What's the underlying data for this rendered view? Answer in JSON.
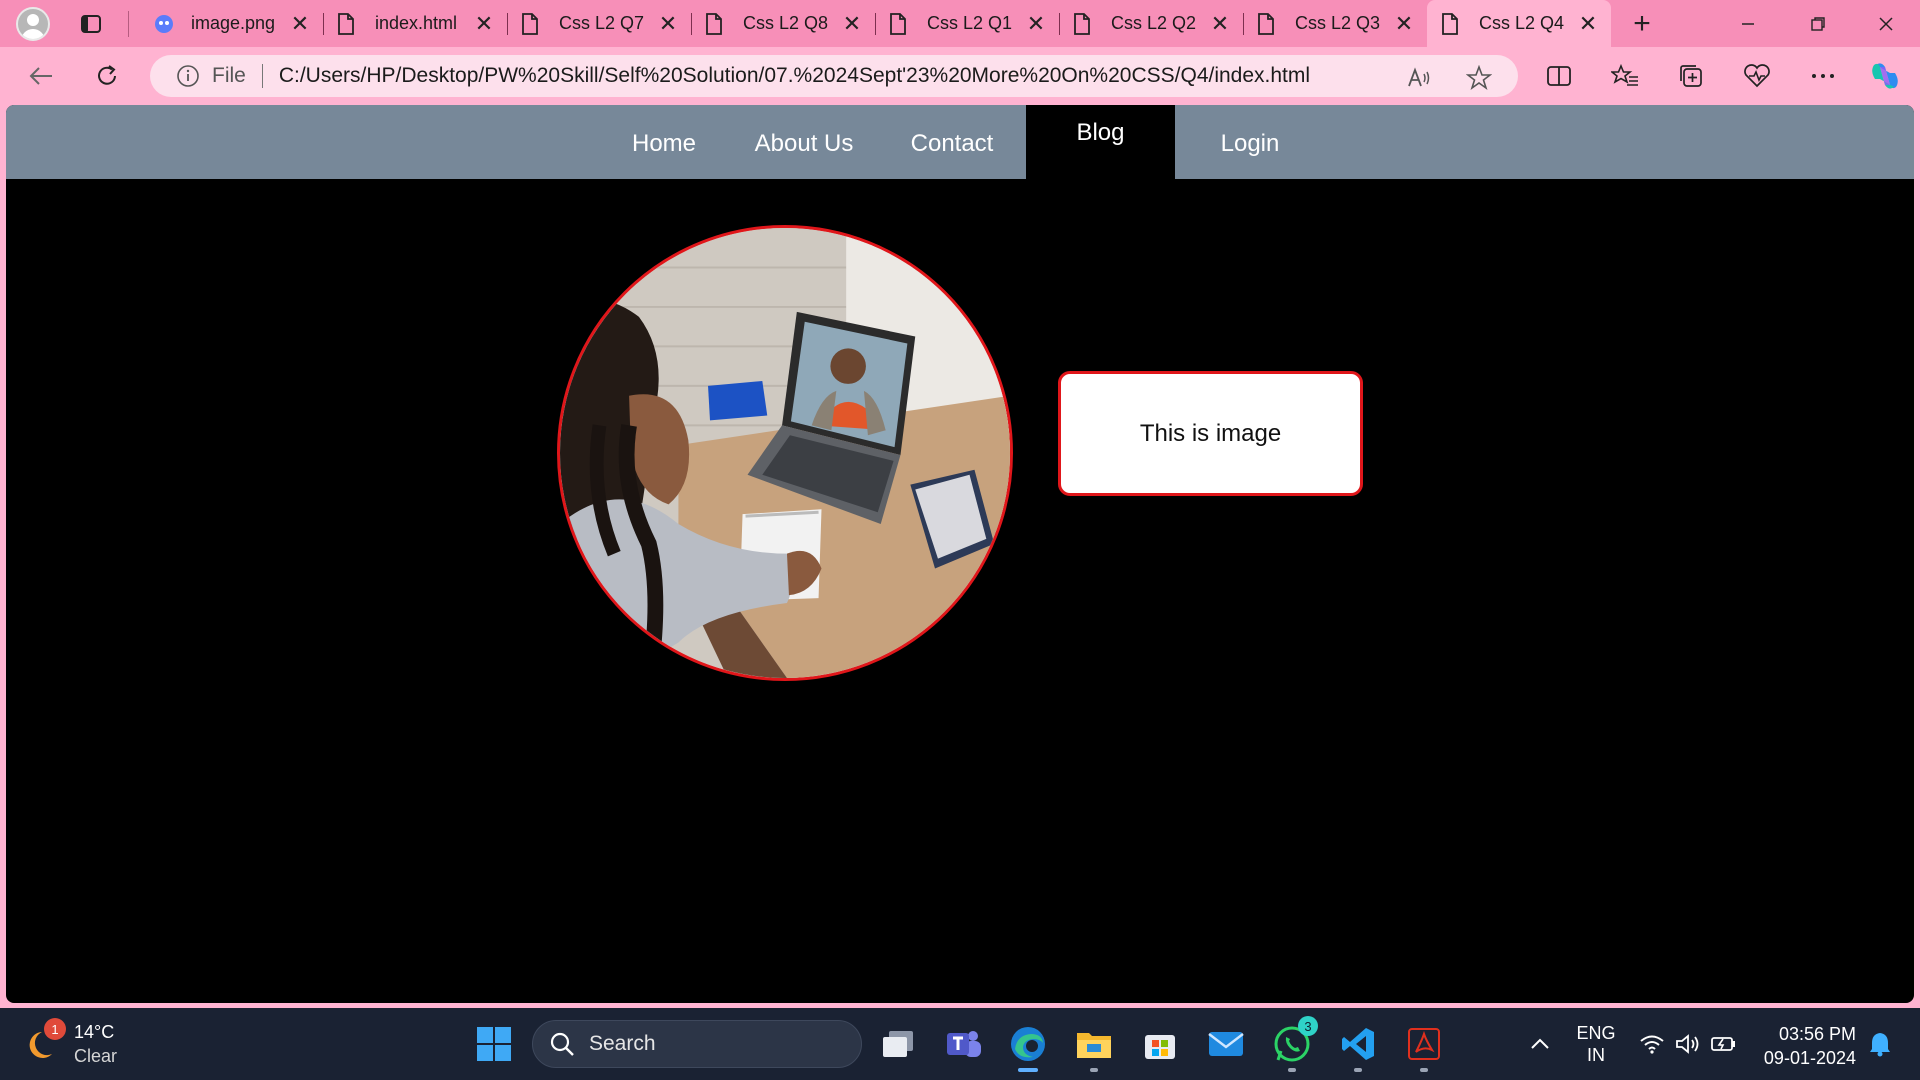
{
  "browser": {
    "tabs": [
      {
        "label": "image.png",
        "icon": "copilot-icon",
        "active": false
      },
      {
        "label": "index.html",
        "icon": "file-icon",
        "active": false
      },
      {
        "label": "Css L2 Q7",
        "icon": "file-icon",
        "active": false
      },
      {
        "label": "Css L2 Q8",
        "icon": "file-icon",
        "active": false
      },
      {
        "label": "Css L2 Q1",
        "icon": "file-icon",
        "active": false
      },
      {
        "label": "Css L2 Q2",
        "icon": "file-icon",
        "active": false
      },
      {
        "label": "Css L2 Q3",
        "icon": "file-icon",
        "active": false
      },
      {
        "label": "Css L2 Q4",
        "icon": "file-icon",
        "active": true
      }
    ],
    "tab_close_glyph": "✕",
    "new_tab_glyph": "+",
    "address": {
      "scheme_label": "File",
      "url": "C:/Users/HP/Desktop/PW%20Skill/Self%20Solution/07.%2024Sept'23%20More%20On%20CSS/Q4/index.html"
    }
  },
  "page": {
    "nav": {
      "items": [
        {
          "label": "Home",
          "active": false
        },
        {
          "label": "About Us",
          "active": false
        },
        {
          "label": "Contact",
          "active": false
        },
        {
          "label": "Blog",
          "active": true
        },
        {
          "label": "Login",
          "active": false
        }
      ]
    },
    "caption": "This is image",
    "colors": {
      "navbar_bg": "#778899",
      "page_bg": "#000000",
      "accent_border": "#e0161a",
      "tab_strip": "#f78fb8",
      "toolbar": "#ffb3d1"
    }
  },
  "taskbar": {
    "weather": {
      "temp": "14°C",
      "condition": "Clear",
      "badge": "1"
    },
    "search_label": "Search",
    "whatsapp_badge": "3",
    "language": {
      "line1": "ENG",
      "line2": "IN"
    },
    "time": "03:56 PM",
    "date": "09-01-2024"
  }
}
